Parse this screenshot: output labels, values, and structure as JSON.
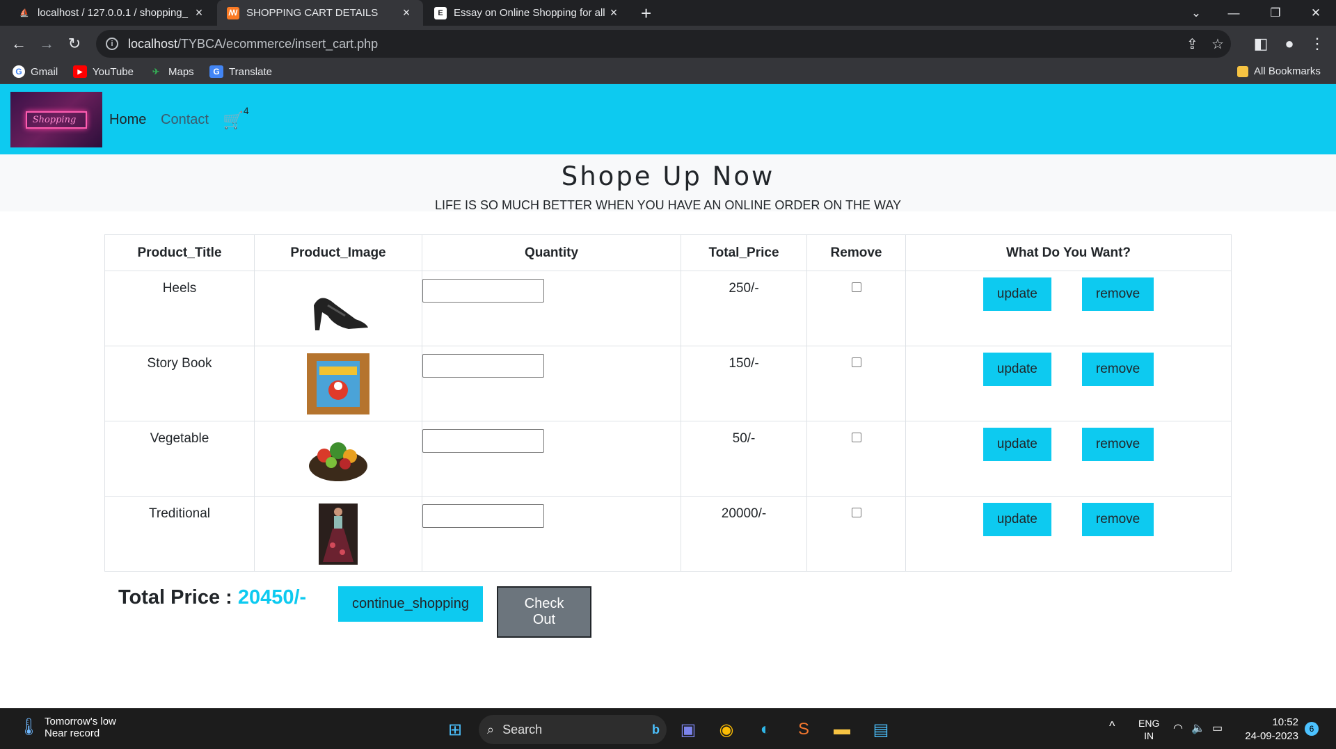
{
  "browser": {
    "tabs": [
      {
        "title": "localhost / 127.0.0.1 / shopping_",
        "icon": "phpmyadmin-icon",
        "active": false
      },
      {
        "title": "SHOPPING CART DETAILS",
        "icon": "xampp-icon",
        "active": true
      },
      {
        "title": "Essay on Online Shopping for all",
        "icon": "essay-site-icon",
        "active": false
      }
    ],
    "new_tab_label": "+",
    "url_host": "localhost",
    "url_path": "/TYBCA/ecommerce/insert_cart.php",
    "bookmarks": [
      "Gmail",
      "YouTube",
      "Maps",
      "Translate"
    ],
    "all_bookmarks": "All Bookmarks"
  },
  "nav": {
    "logo_text": "Shopping",
    "home": "Home",
    "contact": "Contact",
    "cart_count": "4"
  },
  "hero": {
    "title": "Shope Up Now",
    "tagline": "LIFE IS SO MUCH BETTER WHEN YOU HAVE AN ONLINE ORDER ON THE WAY"
  },
  "table": {
    "headers": [
      "Product_Title",
      "Product_Image",
      "Quantity",
      "Total_Price",
      "Remove",
      "What Do You Want?"
    ],
    "rows": [
      {
        "title": "Heels",
        "image": "heels-image",
        "price": "250/-"
      },
      {
        "title": "Story Book",
        "image": "story-book-image",
        "price": "150/-"
      },
      {
        "title": "Vegetable",
        "image": "vegetable-basket-image",
        "price": "50/-"
      },
      {
        "title": "Treditional",
        "image": "traditional-dress-image",
        "price": "20000/-"
      }
    ],
    "update_label": "update",
    "remove_label": "remove"
  },
  "totals": {
    "label": "Total Price :",
    "value": "20450/-",
    "continue_label": "continue_shopping",
    "checkout_label": "Check Out"
  },
  "taskbar": {
    "weather_line1": "Tomorrow's low",
    "weather_line2": "Near record",
    "search_label": "Search",
    "lang1": "ENG",
    "lang2": "IN",
    "time": "10:52",
    "date": "24-09-2023",
    "notifications": "6"
  },
  "colors": {
    "accent": "#0dcaf0",
    "checkout": "#6c757d",
    "browser_dark": "#202124"
  }
}
